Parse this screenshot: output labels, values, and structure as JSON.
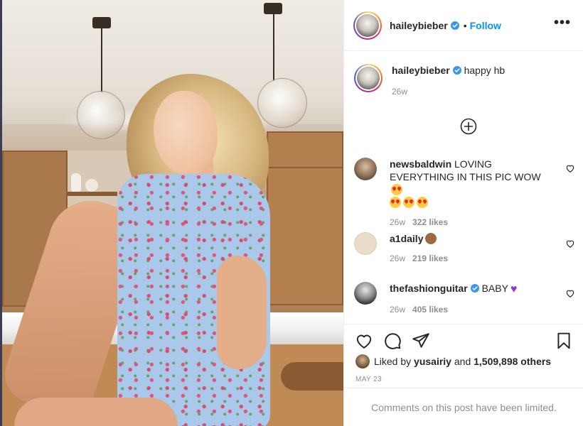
{
  "post": {
    "username": "haileybieber",
    "follow_label": "Follow",
    "separator": "•",
    "more_label": "•••",
    "image_alt": "Photo of a woman in a blue floral dress in a sunlit kitchen"
  },
  "caption": {
    "username": "haileybieber",
    "text": "happy hb",
    "time": "26w"
  },
  "comments": [
    {
      "username": "newsbaldwin",
      "text": "LOVING EVERYTHING IN THIS PIC WOW",
      "time": "26w",
      "likes": "322 likes"
    },
    {
      "username": "a1daily",
      "text": "",
      "time": "26w",
      "likes": "219 likes"
    },
    {
      "username": "thefashionguitar",
      "text": "BABY",
      "time": "26w",
      "likes": "405 likes"
    }
  ],
  "likes": {
    "prefix": "Liked by",
    "user": "yusairiy",
    "middle": "and",
    "count": "1,509,898 others"
  },
  "date": "MAY 23",
  "footer": "Comments on this post have been limited.",
  "colors": {
    "link": "#0095f6",
    "verified": "#3897f0",
    "muted": "#8e8e8e"
  }
}
